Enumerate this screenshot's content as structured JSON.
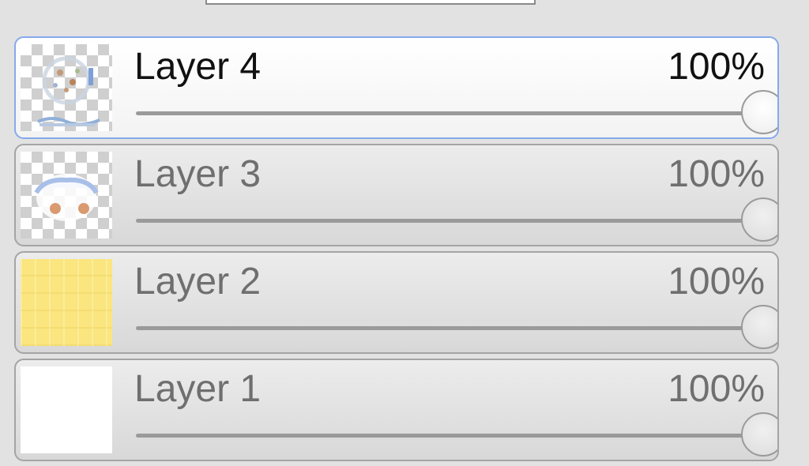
{
  "layers": [
    {
      "name": "Layer 4",
      "opacity_label": "100%",
      "opacity": 1.0,
      "selected": true,
      "thumbnail": "mixed-drawing-thumbnail"
    },
    {
      "name": "Layer 3",
      "opacity_label": "100%",
      "opacity": 1.0,
      "selected": false,
      "thumbnail": "face-drawing-thumbnail"
    },
    {
      "name": "Layer 2",
      "opacity_label": "100%",
      "opacity": 1.0,
      "selected": false,
      "thumbnail": "yellow-fill-thumbnail"
    },
    {
      "name": "Layer 1",
      "opacity_label": "100%",
      "opacity": 1.0,
      "selected": false,
      "thumbnail": "white-thumbnail"
    }
  ],
  "colors": {
    "selected_border": "#86a9ec",
    "unselected_border": "#a4a4a4",
    "layer2_fill": "#fae57f"
  }
}
